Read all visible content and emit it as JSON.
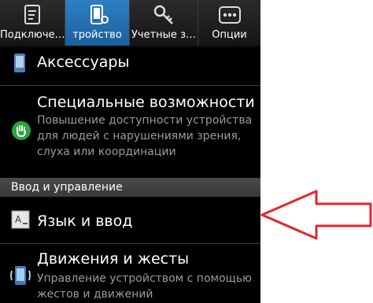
{
  "tabs": [
    {
      "label": "Подключе…",
      "icon": "connections-icon"
    },
    {
      "label": "тройство",
      "icon": "device-icon"
    },
    {
      "label": "Учетные з…",
      "icon": "accounts-icon"
    },
    {
      "label": "Опции",
      "icon": "more-icon"
    }
  ],
  "settings": {
    "accessories": {
      "title": "Аксессуары",
      "icon": "accessory-icon"
    },
    "accessibility": {
      "title": "Специальные возможности",
      "description": "Повышение доступности устройства для людей с нарушениями зрения, слуха или координации",
      "icon": "accessibility-hand-icon"
    },
    "section_header": "Ввод и управление",
    "language": {
      "title": "Язык и ввод",
      "icon": "language-keyboard-icon"
    },
    "motions": {
      "title": "Движения и жесты",
      "description": "Управление устройством с помощью жестов и движений",
      "icon": "motion-icon"
    }
  },
  "annotation": {
    "arrow_color": "#e3262b",
    "icon": "pointer-arrow"
  },
  "colors": {
    "active_tab": "#2e7fc4",
    "background": "#000000",
    "secondary_text": "#9b9b9b"
  }
}
